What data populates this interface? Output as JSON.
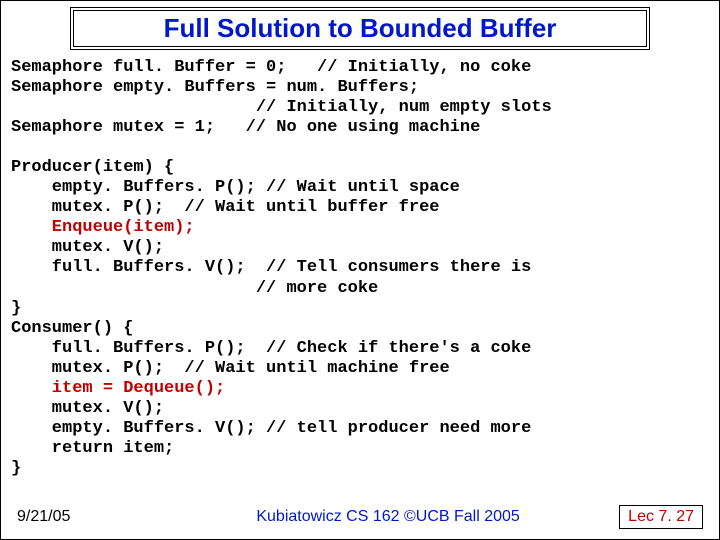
{
  "title": "Full Solution to Bounded Buffer",
  "code": {
    "l01a": "Semaphore full. Buffer = 0;   // Initially, no coke",
    "l02a": "Semaphore empty. Buffers = num. Buffers;",
    "l03a": "                        // Initially, num empty slots",
    "l04a": "Semaphore mutex = 1;   // No one using machine",
    "l05a": "",
    "l06a": "Producer(item) {",
    "l07a": "    empty. Buffers. P(); // Wait until space",
    "l08a": "    mutex. P();  // Wait until buffer free",
    "l09r": "    Enqueue(item);",
    "l10a": "    mutex. V();",
    "l11a": "    full. Buffers. V();  // Tell consumers there is",
    "l12a": "                        // more coke",
    "l13a": "}",
    "l14a": "Consumer() {",
    "l15a": "    full. Buffers. P();  // Check if there's a coke",
    "l16a": "    mutex. P();  // Wait until machine free",
    "l17r": "    item = Dequeue();",
    "l18a": "    mutex. V();",
    "l19a": "    empty. Buffers. V(); // tell producer need more",
    "l20a": "    return item;",
    "l21a": "}"
  },
  "footer": {
    "date": "9/21/05",
    "mid": "Kubiatowicz CS 162 ©UCB Fall 2005",
    "lec": "Lec 7. 27"
  }
}
